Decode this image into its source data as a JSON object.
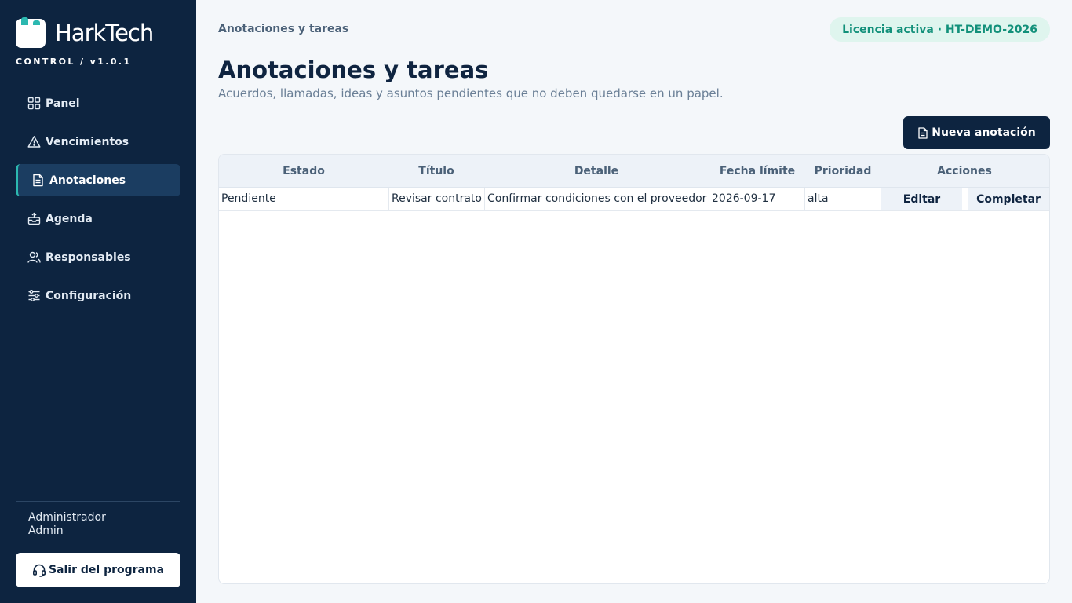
{
  "sidebar": {
    "brand": "HarkTech",
    "subtitle": "CONTROL / v1.0.1",
    "items": [
      {
        "label": "Panel",
        "icon": "grid-icon"
      },
      {
        "label": "Vencimientos",
        "icon": "warning-icon"
      },
      {
        "label": "Anotaciones",
        "icon": "document-icon",
        "active": true
      },
      {
        "label": "Agenda",
        "icon": "tray-upload-icon"
      },
      {
        "label": "Responsables",
        "icon": "users-icon"
      },
      {
        "label": "Configuración",
        "icon": "sliders-icon"
      }
    ],
    "user_role": "Administrador",
    "user_name": "Admin",
    "exit_label": "Salir del programa"
  },
  "header": {
    "breadcrumb": "Anotaciones y tareas",
    "license": "Licencia activa · HT-DEMO-2026"
  },
  "main": {
    "title": "Anotaciones y tareas",
    "subtitle": "Acuerdos, llamadas, ideas y asuntos pendientes que no deben quedarse en un papel.",
    "new_button": "Nueva anotación",
    "table": {
      "columns": [
        "Estado",
        "Título",
        "Detalle",
        "Fecha límite",
        "Prioridad",
        "Acciones"
      ],
      "rows": [
        {
          "estado": "Pendiente",
          "titulo": "Revisar contrato",
          "detalle": "Confirmar condiciones con el proveedor",
          "fecha": "2026-09-17",
          "prioridad": "alta",
          "edit_label": "Editar",
          "complete_label": "Completar"
        }
      ]
    }
  },
  "colors": {
    "sidebar_bg": "#0d2440",
    "active_item_bg": "#1b3d61",
    "accent": "#2cb8b0",
    "license_bg": "#dff5ee",
    "license_text": "#12907a",
    "page_bg": "#f4f7fa"
  }
}
